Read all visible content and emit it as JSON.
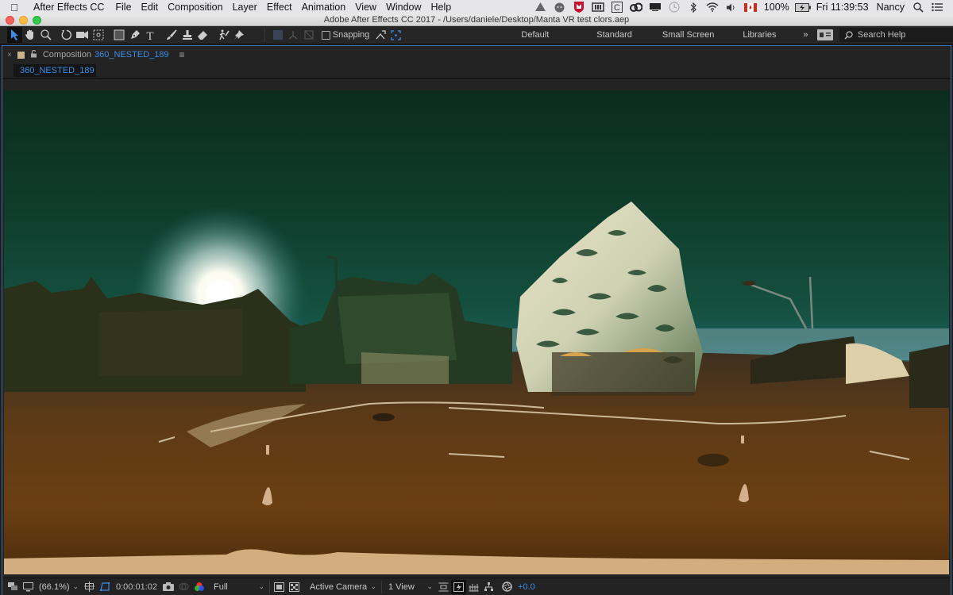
{
  "menubar": {
    "apple_icon": "apple-logo",
    "items": [
      "After Effects CC",
      "File",
      "Edit",
      "Composition",
      "Layer",
      "Effect",
      "Animation",
      "View",
      "Window",
      "Help"
    ],
    "tray_icons": [
      "google-drive-icon",
      "chat-bubble-icon",
      "mcafee-shield-icon",
      "ram-chip-icon",
      "c-box-icon",
      "creative-cloud-icon",
      "display-icon",
      "time-machine-icon",
      "bluetooth-icon",
      "wifi-icon",
      "volume-icon",
      "canada-flag-icon"
    ],
    "battery": "100%",
    "clock": "Fri 11:39:53",
    "user": "Nancy"
  },
  "window": {
    "title": "Adobe After Effects CC 2017 - /Users/daniele/Desktop/Manta VR test clors.aep"
  },
  "toolbar": {
    "tools": [
      "selection-tool",
      "hand-tool",
      "zoom-tool",
      "rotation-tool",
      "camera-tool",
      "pan-behind-tool",
      "rectangle-tool",
      "pen-tool",
      "type-tool",
      "brush-tool",
      "clone-stamp-tool",
      "eraser-tool",
      "roto-brush-tool",
      "puppet-pin-tool"
    ],
    "snapping_label": "Snapping",
    "workspaces": [
      "Default",
      "Standard",
      "Small Screen",
      "Libraries"
    ],
    "overflow": "»",
    "search_placeholder": "Search Help"
  },
  "panel": {
    "close": "×",
    "label": "Composition",
    "comp_name": "360_NESTED_189",
    "menu": "≡",
    "breadcrumb": "360_NESTED_189"
  },
  "viewer": {
    "content": "360 equirectangular street scene with wavy distortion effect"
  },
  "footer": {
    "zoom": "(66.1%)",
    "timecode": "0:00:01:02",
    "resolution": "Full",
    "camera": "Active Camera",
    "views": "1 View",
    "exposure": "+0.0"
  },
  "colors": {
    "accent": "#3b8ee8",
    "panel_border": "#3e6fa8",
    "ui_bg": "#232323"
  }
}
